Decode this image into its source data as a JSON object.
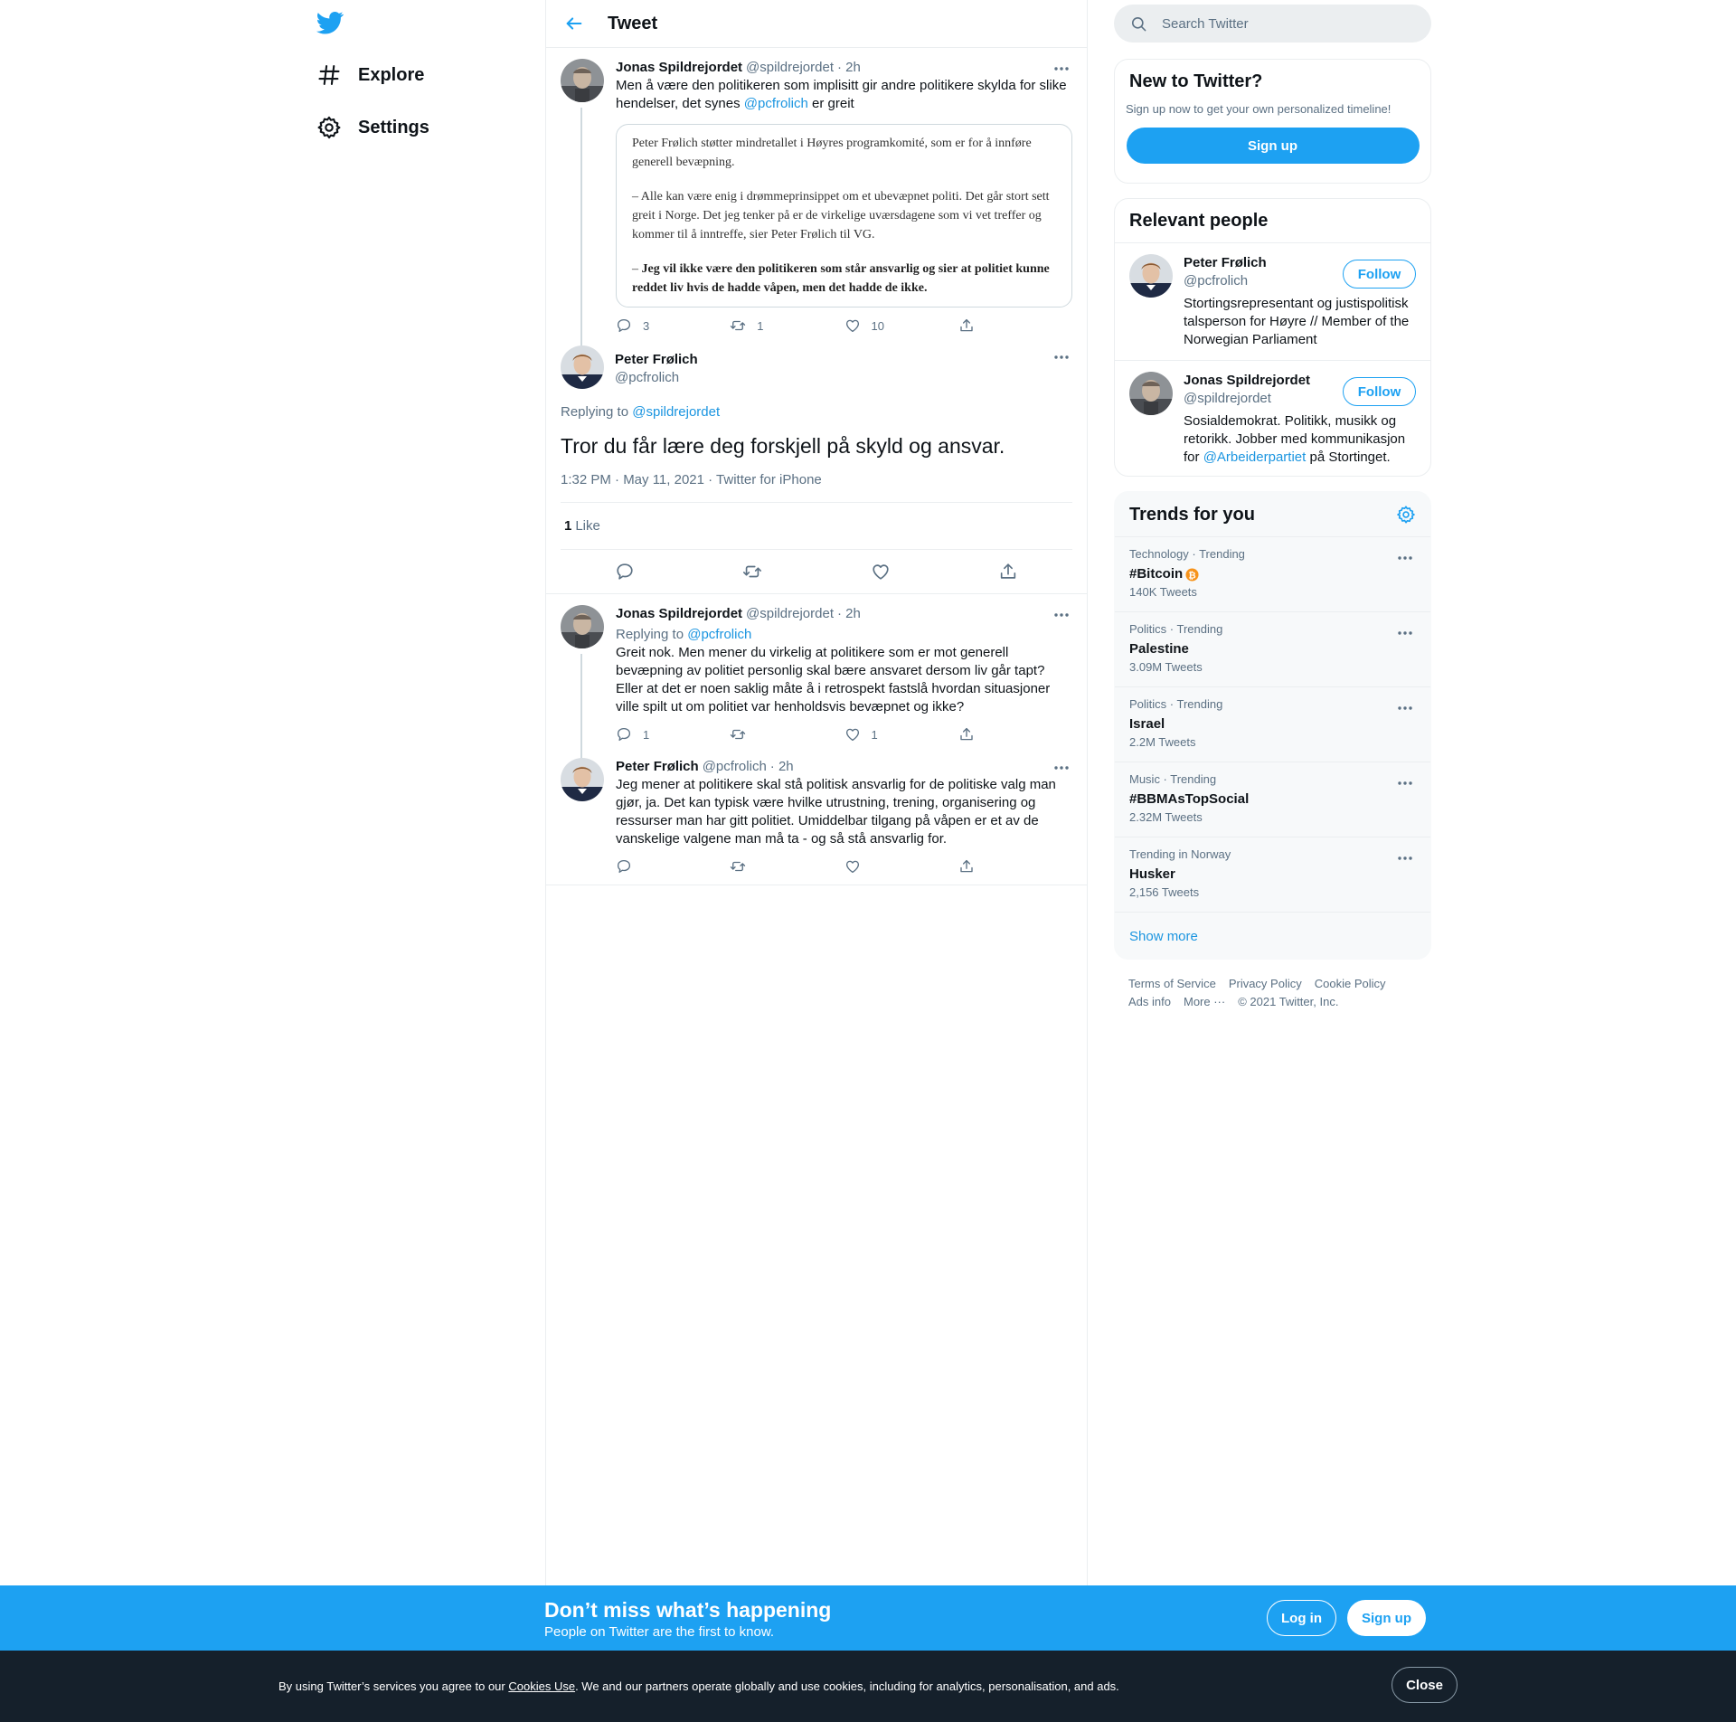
{
  "nav": {
    "explore": "Explore",
    "settings": "Settings"
  },
  "header": {
    "title": "Tweet"
  },
  "thread": [
    {
      "name": "Jonas Spildrejordet",
      "handle": "@spildrejordet",
      "time": "· 2h",
      "text_before": "Men å være den politikeren som implisitt gir andre politikere skylda for slike hendelser, det synes ",
      "mention": "@pcfrolich",
      "text_after": " er greit",
      "image_text": {
        "p1": "Peter Frølich støtter mindretallet i Høyres programkomité, som er for å innføre generell bevæpning.",
        "p2": "– Alle kan være enig i drømmeprinsippet om et ubevæpnet politi. Det går stort sett greit i Norge. Det jeg tenker på er de virkelige uværsdagene som vi vet treffer og kommer til å inntreffe, sier Peter Frølich til VG.",
        "p3_dash": "– ",
        "p3_bold": "Jeg vil ikke være den politikeren som står ansvarlig og sier at politiet kunne reddet liv hvis de hadde våpen, men det hadde de ikke."
      },
      "replies": "3",
      "retweets": "1",
      "likes": "10"
    }
  ],
  "focus": {
    "name": "Peter Frølich",
    "handle": "@pcfrolich",
    "replying_label": "Replying to ",
    "replying_to": "@spildrejordet",
    "text": "Tror du får lære deg forskjell på skyld og ansvar.",
    "meta": "1:32 PM · May 11, 2021 · Twitter for iPhone",
    "like_count": "1",
    "like_label": "Like"
  },
  "replies": [
    {
      "name": "Jonas Spildrejordet",
      "handle": "@spildrejordet",
      "time": "· 2h",
      "replying_label": "Replying to ",
      "replying_to": "@pcfrolich",
      "text": "Greit nok. Men mener du virkelig at politikere som er mot generell bevæpning av politiet personlig skal bære ansvaret dersom liv går tapt? Eller at det er noen saklig måte å i retrospekt fastslå hvordan situasjoner ville spilt ut om politiet var henholdsvis bevæpnet og ikke?",
      "replies": "1",
      "retweets": "",
      "likes": "1"
    },
    {
      "name": "Peter Frølich",
      "handle": "@pcfrolich",
      "time": "· 2h",
      "text": "Jeg mener at politikere skal stå politisk ansvarlig for de politiske valg man gjør, ja. Det kan typisk være hvilke utrustning, trening, organisering og ressurser man har gitt politiet. Umiddelbar tilgang på våpen er et av de vanskelige valgene man må ta - og så stå ansvarlig for.",
      "replies": "",
      "retweets": "",
      "likes": ""
    }
  ],
  "sidebar": {
    "search_placeholder": "Search Twitter",
    "new_title": "New to Twitter?",
    "new_sub": "Sign up now to get your own personalized timeline!",
    "signup": "Sign up",
    "people_title": "Relevant people",
    "follow": "Follow",
    "people": [
      {
        "name": "Peter Frølich",
        "handle": "@pcfrolich",
        "bio": "Stortingsrepresentant og justispolitisk talsperson for Høyre // Member of the Norwegian Parliament"
      },
      {
        "name": "Jonas Spildrejordet",
        "handle": "@spildrejordet",
        "bio_before": "Sosialdemokrat. Politikk, musikk og retorikk. Jobber med kommunikasjon for ",
        "bio_mention": "@Arbeiderpartiet",
        "bio_after": " på Stortinget."
      }
    ],
    "trends_title": "Trends for you",
    "trends": [
      {
        "category": "Technology · Trending",
        "name": "#Bitcoin",
        "count": "140K Tweets"
      },
      {
        "category": "Politics · Trending",
        "name": "Palestine",
        "count": "3.09M Tweets"
      },
      {
        "category": "Politics · Trending",
        "name": "Israel",
        "count": "2.2M Tweets"
      },
      {
        "category": "Music · Trending",
        "name": "#BBMAsTopSocial",
        "count": "2.32M Tweets"
      },
      {
        "category": "Trending in Norway",
        "name": "Husker",
        "count": "2,156 Tweets"
      }
    ],
    "show_more": "Show more",
    "footer": {
      "terms": "Terms of Service",
      "privacy": "Privacy Policy",
      "cookie": "Cookie Policy",
      "ads": "Ads info",
      "more": "More ···",
      "copyright": "© 2021 Twitter, Inc."
    }
  },
  "banner": {
    "title": "Don’t miss what’s happening",
    "subtitle": "People on Twitter are the first to know.",
    "login": "Log in",
    "signup": "Sign up"
  },
  "cookie": {
    "before": "By using Twitter’s services you agree to our ",
    "link": "Cookies Use",
    "after": ". We and our partners operate globally and use cookies, including for analytics, personalisation, and ads.",
    "close": "Close"
  },
  "colors": {
    "accent": "#1da1f2",
    "link": "#1b95e0",
    "muted": "#5b7083",
    "cookie_bg": "#15202b",
    "bitcoin": "#f7931a"
  }
}
